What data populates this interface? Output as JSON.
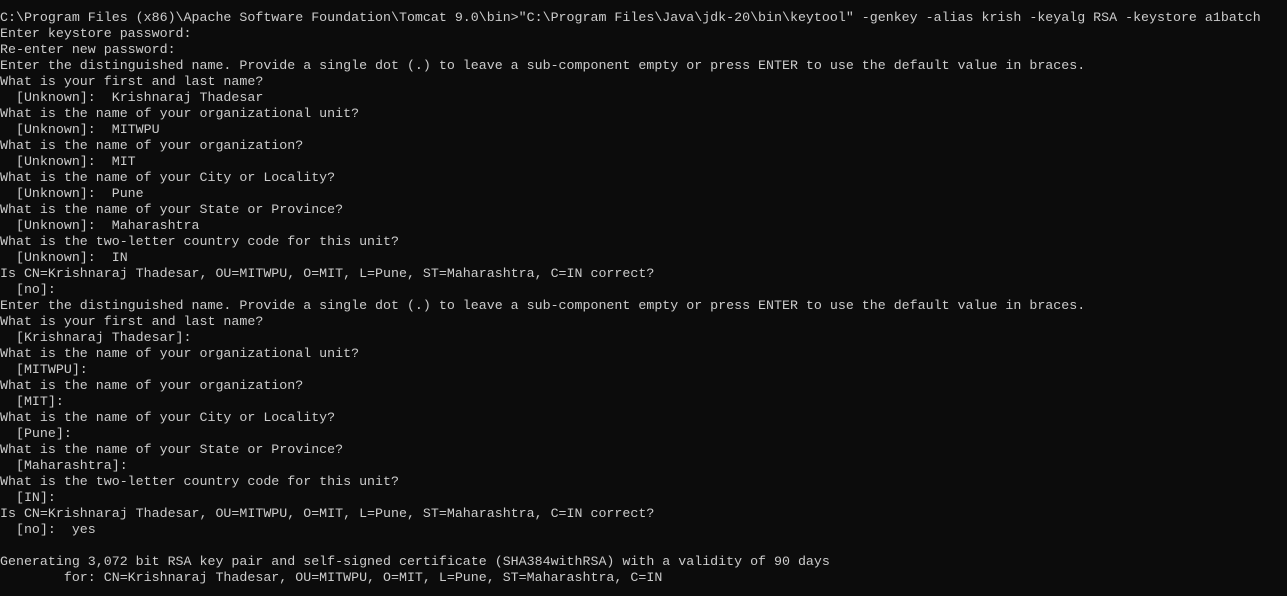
{
  "terminal": {
    "lines": [
      "C:\\Program Files (x86)\\Apache Software Foundation\\Tomcat 9.0\\bin>\"C:\\Program Files\\Java\\jdk-20\\bin\\keytool\" -genkey -alias krish -keyalg RSA -keystore a1batch",
      "Enter keystore password:",
      "Re-enter new password:",
      "Enter the distinguished name. Provide a single dot (.) to leave a sub-component empty or press ENTER to use the default value in braces.",
      "What is your first and last name?",
      "  [Unknown]:  Krishnaraj Thadesar",
      "What is the name of your organizational unit?",
      "  [Unknown]:  MITWPU",
      "What is the name of your organization?",
      "  [Unknown]:  MIT",
      "What is the name of your City or Locality?",
      "  [Unknown]:  Pune",
      "What is the name of your State or Province?",
      "  [Unknown]:  Maharashtra",
      "What is the two-letter country code for this unit?",
      "  [Unknown]:  IN",
      "Is CN=Krishnaraj Thadesar, OU=MITWPU, O=MIT, L=Pune, ST=Maharashtra, C=IN correct?",
      "  [no]:",
      "Enter the distinguished name. Provide a single dot (.) to leave a sub-component empty or press ENTER to use the default value in braces.",
      "What is your first and last name?",
      "  [Krishnaraj Thadesar]:",
      "What is the name of your organizational unit?",
      "  [MITWPU]:",
      "What is the name of your organization?",
      "  [MIT]:",
      "What is the name of your City or Locality?",
      "  [Pune]:",
      "What is the name of your State or Province?",
      "  [Maharashtra]:",
      "What is the two-letter country code for this unit?",
      "  [IN]:",
      "Is CN=Krishnaraj Thadesar, OU=MITWPU, O=MIT, L=Pune, ST=Maharashtra, C=IN correct?",
      "  [no]:  yes",
      "",
      "Generating 3,072 bit RSA key pair and self-signed certificate (SHA384withRSA) with a validity of 90 days",
      "        for: CN=Krishnaraj Thadesar, OU=MITWPU, O=MIT, L=Pune, ST=Maharashtra, C=IN"
    ]
  }
}
